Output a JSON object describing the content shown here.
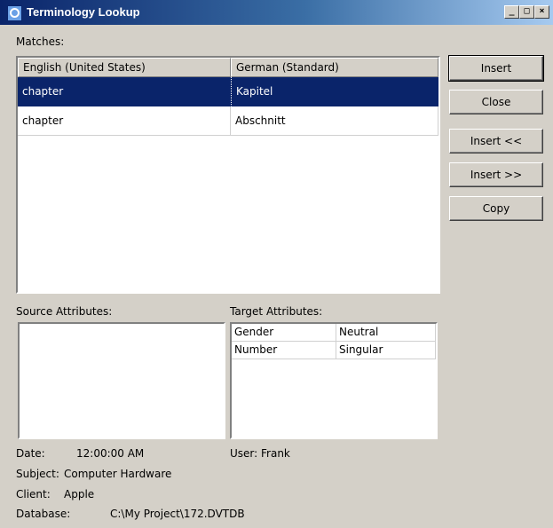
{
  "window": {
    "title": "Terminology Lookup",
    "controls": {
      "minimize": "_",
      "maximize": "□",
      "close": "×"
    }
  },
  "matches": {
    "label": "Matches:",
    "columns": [
      "English (United States)",
      "German (Standard)"
    ],
    "rows": [
      {
        "source": "chapter",
        "target": "Kapitel",
        "selected": true
      },
      {
        "source": "chapter",
        "target": "Abschnitt",
        "selected": false
      }
    ]
  },
  "buttons": {
    "insert": "Insert",
    "close": "Close",
    "insert_prev": "Insert <<",
    "insert_next": "Insert >>",
    "copy": "Copy"
  },
  "source_attributes": {
    "label": "Source Attributes:"
  },
  "target_attributes": {
    "label": "Target Attributes:",
    "rows": [
      {
        "name": "Gender",
        "value": "Neutral"
      },
      {
        "name": "Number",
        "value": "Singular"
      }
    ]
  },
  "info": {
    "date_label": "Date:",
    "date_value": "12:00:00 AM",
    "user_text": "User: Frank",
    "subject_label": "Subject:",
    "subject_value": "Computer Hardware",
    "client_label": "Client:",
    "client_value": "Apple",
    "database_label": "Database:",
    "database_value": "C:\\My Project\\172.DVTDB"
  },
  "colors": {
    "selection": "#0a246a",
    "face": "#d4d0c8"
  }
}
